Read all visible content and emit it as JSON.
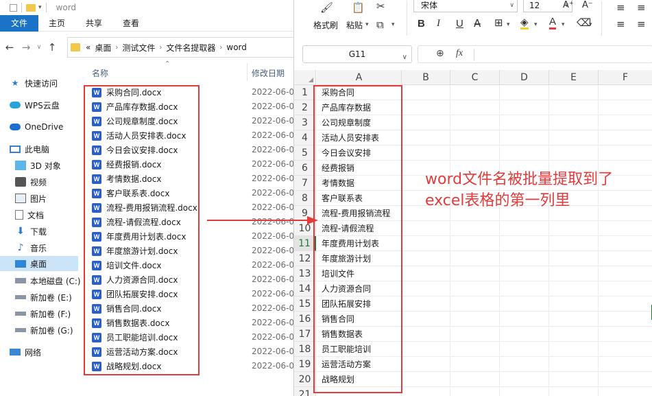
{
  "explorer": {
    "title": "word",
    "tabs": [
      {
        "label": "文件",
        "active": true
      },
      {
        "label": "主页",
        "active": false
      },
      {
        "label": "共享",
        "active": false
      },
      {
        "label": "查看",
        "active": false
      }
    ],
    "breadcrumb": [
      "«",
      "桌面",
      "测试文件",
      "文件名提取器",
      "word"
    ],
    "sidebar": [
      {
        "label": "快速访问",
        "icon": "star-icon"
      },
      {
        "label": "WPS云盘",
        "icon": "cloud-icon"
      },
      {
        "label": "OneDrive",
        "icon": "onedrive-icon"
      },
      {
        "label": "此电脑",
        "icon": "computer-icon"
      },
      {
        "label": "3D 对象",
        "icon": "cube-icon"
      },
      {
        "label": "视频",
        "icon": "video-icon"
      },
      {
        "label": "图片",
        "icon": "picture-icon"
      },
      {
        "label": "文档",
        "icon": "document-icon"
      },
      {
        "label": "下载",
        "icon": "download-icon"
      },
      {
        "label": "音乐",
        "icon": "music-icon"
      },
      {
        "label": "桌面",
        "icon": "desktop-icon",
        "selected": true
      },
      {
        "label": "本地磁盘 (C:)",
        "icon": "drive-icon"
      },
      {
        "label": "新加卷 (E:)",
        "icon": "drive-icon"
      },
      {
        "label": "新加卷 (F:)",
        "icon": "drive-icon"
      },
      {
        "label": "新加卷 (G:)",
        "icon": "drive-icon"
      },
      {
        "label": "网络",
        "icon": "network-icon"
      }
    ],
    "columns": {
      "name": "名称",
      "date": "修改日期"
    },
    "files": [
      {
        "name": "采购合同.docx",
        "date": "2022-06-0"
      },
      {
        "name": "产品库存数据.docx",
        "date": "2022-06-0"
      },
      {
        "name": "公司规章制度.docx",
        "date": "2022-06-0"
      },
      {
        "name": "活动人员安排表.docx",
        "date": "2022-06-0"
      },
      {
        "name": "今日会议安排.docx",
        "date": "2022-06-0"
      },
      {
        "name": "经费报销.docx",
        "date": "2022-06-0"
      },
      {
        "name": "考情数据.docx",
        "date": "2022-06-0"
      },
      {
        "name": "客户联系表.docx",
        "date": "2022-06-0"
      },
      {
        "name": "流程-费用报销流程.docx",
        "date": "2022-06-0"
      },
      {
        "name": "流程-请假流程.docx",
        "date": "2022-06-0"
      },
      {
        "name": "年度费用计划表.docx",
        "date": "2022-06-0"
      },
      {
        "name": "年度旅游计划.docx",
        "date": "2022-06-0"
      },
      {
        "name": "培训文件.docx",
        "date": "2022-06-0"
      },
      {
        "name": "人力资源合同.docx",
        "date": "2022-06-0"
      },
      {
        "name": "团队拓展安排.docx",
        "date": "2022-06-0"
      },
      {
        "name": "销售合同.docx",
        "date": "2022-06-0"
      },
      {
        "name": "销售数据表.docx",
        "date": "2022-06-0"
      },
      {
        "name": "员工职能培训.docx",
        "date": "2022-06-0"
      },
      {
        "name": "运营活动方案.docx",
        "date": "2022-06-0"
      },
      {
        "name": "战略规划.docx",
        "date": "2022-06-0"
      }
    ]
  },
  "excel": {
    "toolbar": {
      "format_painter": "格式刷",
      "paste": "粘贴",
      "font_name": "宋体",
      "font_size": "12",
      "bold": "B",
      "italic": "I",
      "underline": "U",
      "font_color_letter": "A"
    },
    "name_box": "G11",
    "fx_label": "fx",
    "columns": [
      "A",
      "B",
      "C",
      "D",
      "E",
      "F"
    ],
    "active_row": "11",
    "rows": [
      {
        "num": "1",
        "a": "采购合同"
      },
      {
        "num": "2",
        "a": "产品库存数据"
      },
      {
        "num": "3",
        "a": "公司规章制度"
      },
      {
        "num": "4",
        "a": "活动人员安排表"
      },
      {
        "num": "5",
        "a": "今日会议安排"
      },
      {
        "num": "6",
        "a": "经费报销"
      },
      {
        "num": "7",
        "a": "考情数据"
      },
      {
        "num": "8",
        "a": "客户联系表"
      },
      {
        "num": "9",
        "a": "流程-费用报销流程"
      },
      {
        "num": "10",
        "a": "流程-请假流程"
      },
      {
        "num": "11",
        "a": "年度费用计划表"
      },
      {
        "num": "12",
        "a": "年度旅游计划"
      },
      {
        "num": "13",
        "a": "培训文件"
      },
      {
        "num": "14",
        "a": "人力资源合同"
      },
      {
        "num": "15",
        "a": "团队拓展安排"
      },
      {
        "num": "16",
        "a": "销售合同"
      },
      {
        "num": "17",
        "a": "销售数据表"
      },
      {
        "num": "18",
        "a": "员工职能培训"
      },
      {
        "num": "19",
        "a": "运营活动方案"
      },
      {
        "num": "20",
        "a": "战略规划"
      },
      {
        "num": "21",
        "a": ""
      }
    ]
  },
  "annotation": {
    "line1": "word文件名被批量提取到了",
    "line2": "excel表格的第一列里"
  },
  "colors": {
    "highlight": "#e33b3b",
    "word_blue": "#2b5fc7",
    "ribbon_blue": "#1a73c7",
    "excel_green": "#1f7a3f"
  }
}
